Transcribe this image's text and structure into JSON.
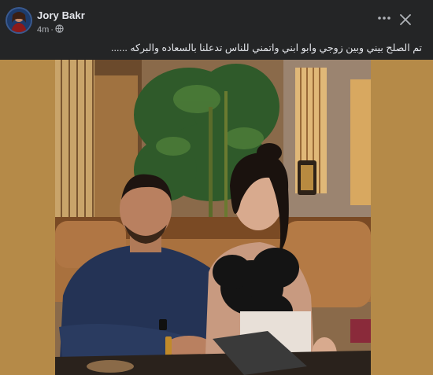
{
  "post": {
    "author": "Jory Bakr",
    "time": "4m",
    "privacy_icon": "globe-icon",
    "caption": "تم الصلح بيني وبين زوجي وابو ابني واتمني للناس تدعلنا بالسعاده والبركه ......"
  },
  "icons": {
    "more": "more-horizontal-icon",
    "close": "close-icon"
  },
  "colors": {
    "background": "#242526",
    "text": "#e4e6eb",
    "meta_text": "#b0b3b8",
    "media_backdrop": "#b58a48"
  }
}
